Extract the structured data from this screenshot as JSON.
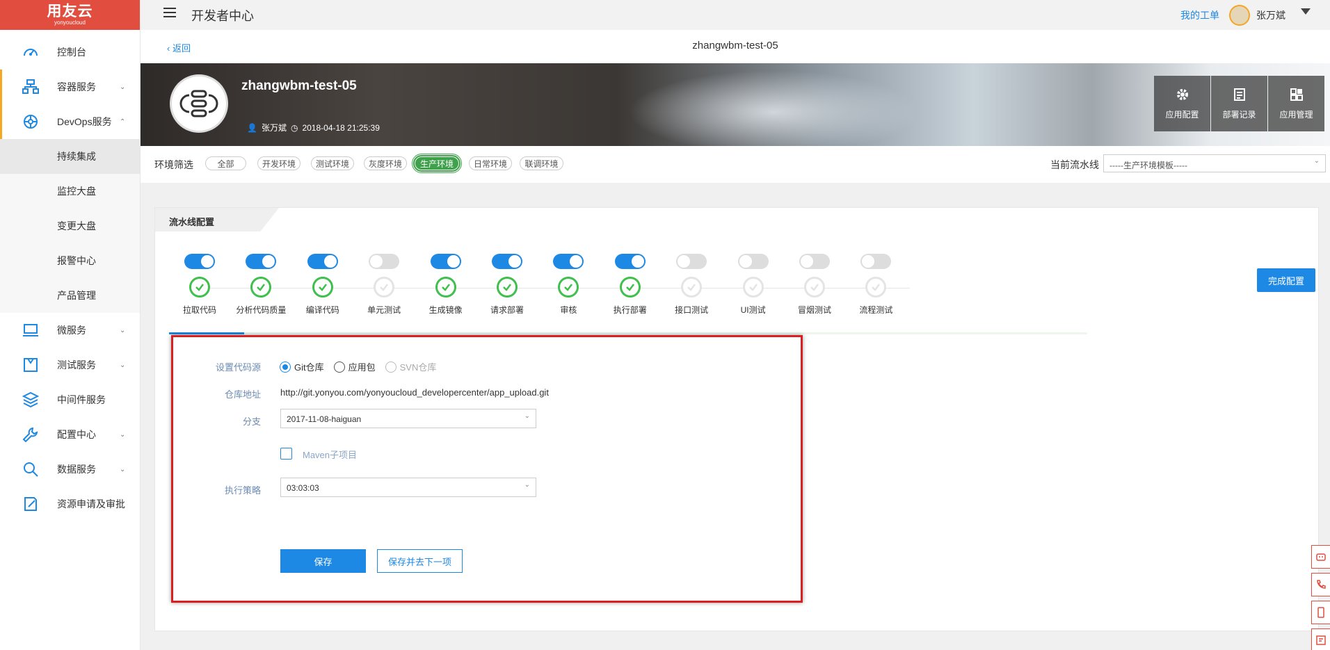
{
  "brand": {
    "name": "用友云",
    "sub": "yonyoucloud"
  },
  "topbar": {
    "title": "开发者中心",
    "my_work": "我的工单",
    "user": "张万斌"
  },
  "sidebar": {
    "items": [
      {
        "label": "控制台",
        "icon": "dashboard-icon",
        "chevron": ""
      },
      {
        "label": "容器服务",
        "icon": "container-icon",
        "chevron": "⌄"
      },
      {
        "label": "DevOps服务",
        "icon": "devops-icon",
        "chevron": "⌃"
      }
    ],
    "sub_items": [
      "持续集成",
      "监控大盘",
      "变更大盘",
      "报警中心",
      "产品管理"
    ],
    "items2": [
      {
        "label": "微服务",
        "icon": "laptop-icon",
        "chevron": "⌄"
      },
      {
        "label": "测试服务",
        "icon": "test-icon",
        "chevron": "⌄"
      },
      {
        "label": "中间件服务",
        "icon": "layers-icon",
        "chevron": ""
      },
      {
        "label": "配置中心",
        "icon": "wrench-icon",
        "chevron": "⌄"
      },
      {
        "label": "数据服务",
        "icon": "search-data-icon",
        "chevron": "⌄"
      },
      {
        "label": "资源申请及审批",
        "icon": "approve-icon",
        "chevron": ""
      }
    ]
  },
  "subhead": {
    "back": "返回",
    "title": "zhangwbm-test-05"
  },
  "banner": {
    "app_name": "zhangwbm-test-05",
    "owner": "张万斌",
    "created": "2018-04-18 21:25:39",
    "actions": [
      {
        "label": "应用配置",
        "icon": "gear-icon"
      },
      {
        "label": "部署记录",
        "icon": "record-icon"
      },
      {
        "label": "应用管理",
        "icon": "apps-icon"
      }
    ]
  },
  "env": {
    "label": "环境筛选",
    "chips": [
      "全部",
      "开发环境",
      "测试环境",
      "灰度环境",
      "生产环境",
      "日常环境",
      "联调环境"
    ],
    "active_index": 4,
    "current_label": "当前流水线",
    "current_value": "-----生产环境模板-----"
  },
  "pipeline": {
    "tab": "流水线配置",
    "done_button": "完成配置",
    "steps": [
      {
        "label": "拉取代码",
        "on": true
      },
      {
        "label": "分析代码质量",
        "on": true
      },
      {
        "label": "编译代码",
        "on": true
      },
      {
        "label": "单元测试",
        "on": false
      },
      {
        "label": "生成镜像",
        "on": true
      },
      {
        "label": "请求部署",
        "on": true
      },
      {
        "label": "审核",
        "on": true
      },
      {
        "label": "执行部署",
        "on": true
      },
      {
        "label": "接口测试",
        "on": false
      },
      {
        "label": "UI测试",
        "on": false
      },
      {
        "label": "冒烟测试",
        "on": false
      },
      {
        "label": "流程测试",
        "on": false
      }
    ]
  },
  "form": {
    "source_label": "设置代码源",
    "source_options": [
      "Git仓库",
      "应用包",
      "SVN仓库"
    ],
    "repo_label": "仓库地址",
    "repo_value": "http://git.yonyou.com/yonyoucloud_developercenter/app_upload.git",
    "branch_label": "分支",
    "branch_value": "2017-11-08-haiguan",
    "maven_label": "Maven子项目",
    "strategy_label": "执行策略",
    "strategy_value": "03:03:03",
    "save": "保存",
    "save_next": "保存并去下一项"
  }
}
